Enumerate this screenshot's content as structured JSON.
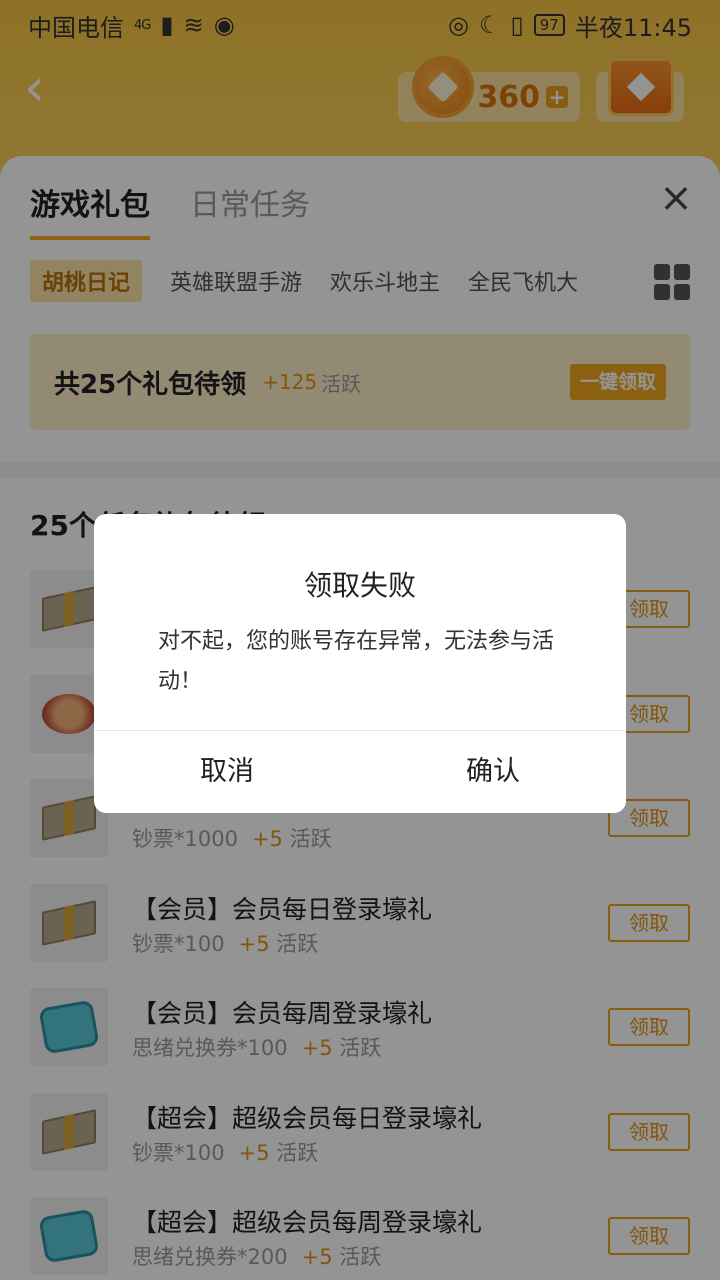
{
  "status_bar": {
    "carrier": "中国电信",
    "network": "4G",
    "battery": "97",
    "time": "半夜11:45"
  },
  "header": {
    "coins": "360",
    "coin_plus": "+"
  },
  "sheet": {
    "tabs": [
      {
        "label": "游戏礼包",
        "active": true
      },
      {
        "label": "日常任务",
        "active": false
      }
    ],
    "close_icon": "×",
    "game_tabs": [
      "胡桃日记",
      "英雄联盟手游",
      "欢乐斗地主",
      "全民飞机大"
    ],
    "summary": {
      "title": "共25个礼包待领",
      "points": "+125",
      "points_label": "活跃",
      "button": "一键领取"
    },
    "section_title": "25个任务礼包待领"
  },
  "tasks": [
    {
      "title": "",
      "reward": "",
      "points": "",
      "points_label": "",
      "button": "领取",
      "icon": "money-icon"
    },
    {
      "title": "",
      "reward": "",
      "points": "",
      "points_label": "",
      "button": "领取",
      "icon": "food-icon"
    },
    {
      "title": "",
      "reward": "钞票*1000",
      "points": "+5",
      "points_label": "活跃",
      "button": "领取",
      "icon": "money-icon"
    },
    {
      "title": "【会员】会员每日登录壕礼",
      "reward": "钞票*100",
      "points": "+5",
      "points_label": "活跃",
      "button": "领取",
      "icon": "money-icon"
    },
    {
      "title": "【会员】会员每周登录壕礼",
      "reward": "思绪兑换券*100",
      "points": "+5",
      "points_label": "活跃",
      "button": "领取",
      "icon": "ticket-icon"
    },
    {
      "title": "【超会】超级会员每日登录壕礼",
      "reward": "钞票*100",
      "points": "+5",
      "points_label": "活跃",
      "button": "领取",
      "icon": "money-icon"
    },
    {
      "title": "【超会】超级会员每周登录壕礼",
      "reward": "思绪兑换券*200",
      "points": "+5",
      "points_label": "活跃",
      "button": "领取",
      "icon": "ticket-icon"
    }
  ],
  "dialog": {
    "title": "领取失败",
    "message": "对不起，您的账号存在异常，无法参与活动！",
    "cancel": "取消",
    "confirm": "确认"
  },
  "colors": {
    "accent": "#f5a623",
    "header_bg": "#f6c443",
    "points": "#e09316"
  }
}
